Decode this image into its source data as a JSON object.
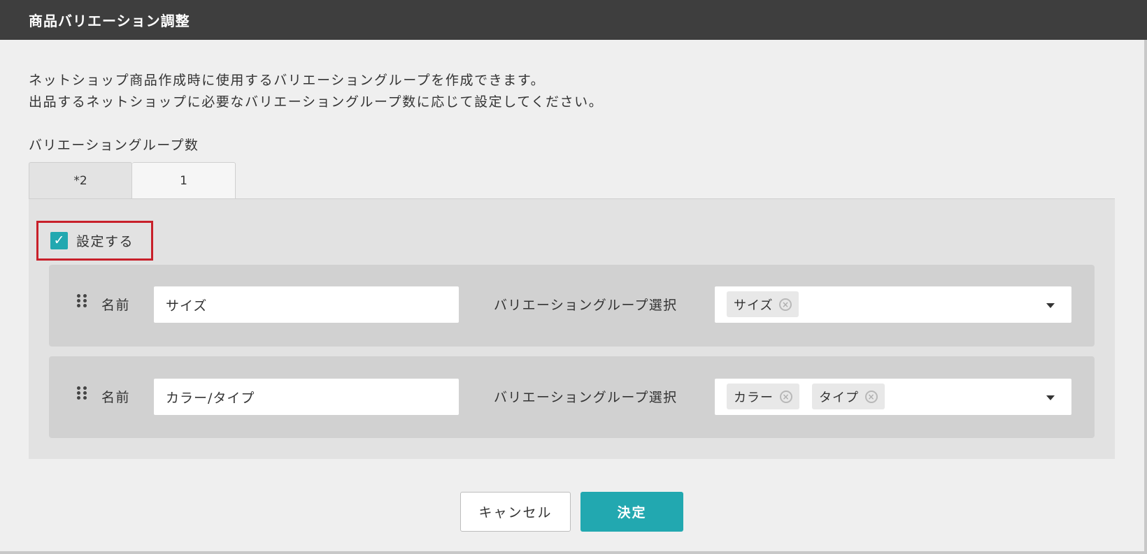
{
  "dialog": {
    "title": "商品バリエーション調整"
  },
  "description": {
    "line1": "ネットショップ商品作成時に使用するバリエーショングループを作成できます。",
    "line2": "出品するネットショップに必要なバリエーショングループ数に応じて設定してください。"
  },
  "group_count": {
    "label": "バリエーショングループ数",
    "tabs": [
      {
        "label": "*2",
        "selected": true
      },
      {
        "label": "1",
        "selected": false
      }
    ]
  },
  "setting": {
    "label": "設定する",
    "checked": true
  },
  "rows": [
    {
      "name_label": "名前",
      "name_value": "サイズ",
      "group_label": "バリエーショングループ選択",
      "chips": [
        "サイズ"
      ]
    },
    {
      "name_label": "名前",
      "name_value": "カラー/タイプ",
      "group_label": "バリエーショングループ選択",
      "chips": [
        "カラー",
        "タイプ"
      ]
    }
  ],
  "buttons": {
    "cancel": "キャンセル",
    "ok": "決定"
  },
  "colors": {
    "titlebar": "#3e3e3e",
    "accent": "#22a8b0",
    "highlight_border": "#c8202a"
  },
  "icons": {
    "checkbox": "check-icon",
    "drag": "drag-handle-icon",
    "chip_remove": "clear-circle-icon",
    "dropdown": "caret-down-icon"
  }
}
